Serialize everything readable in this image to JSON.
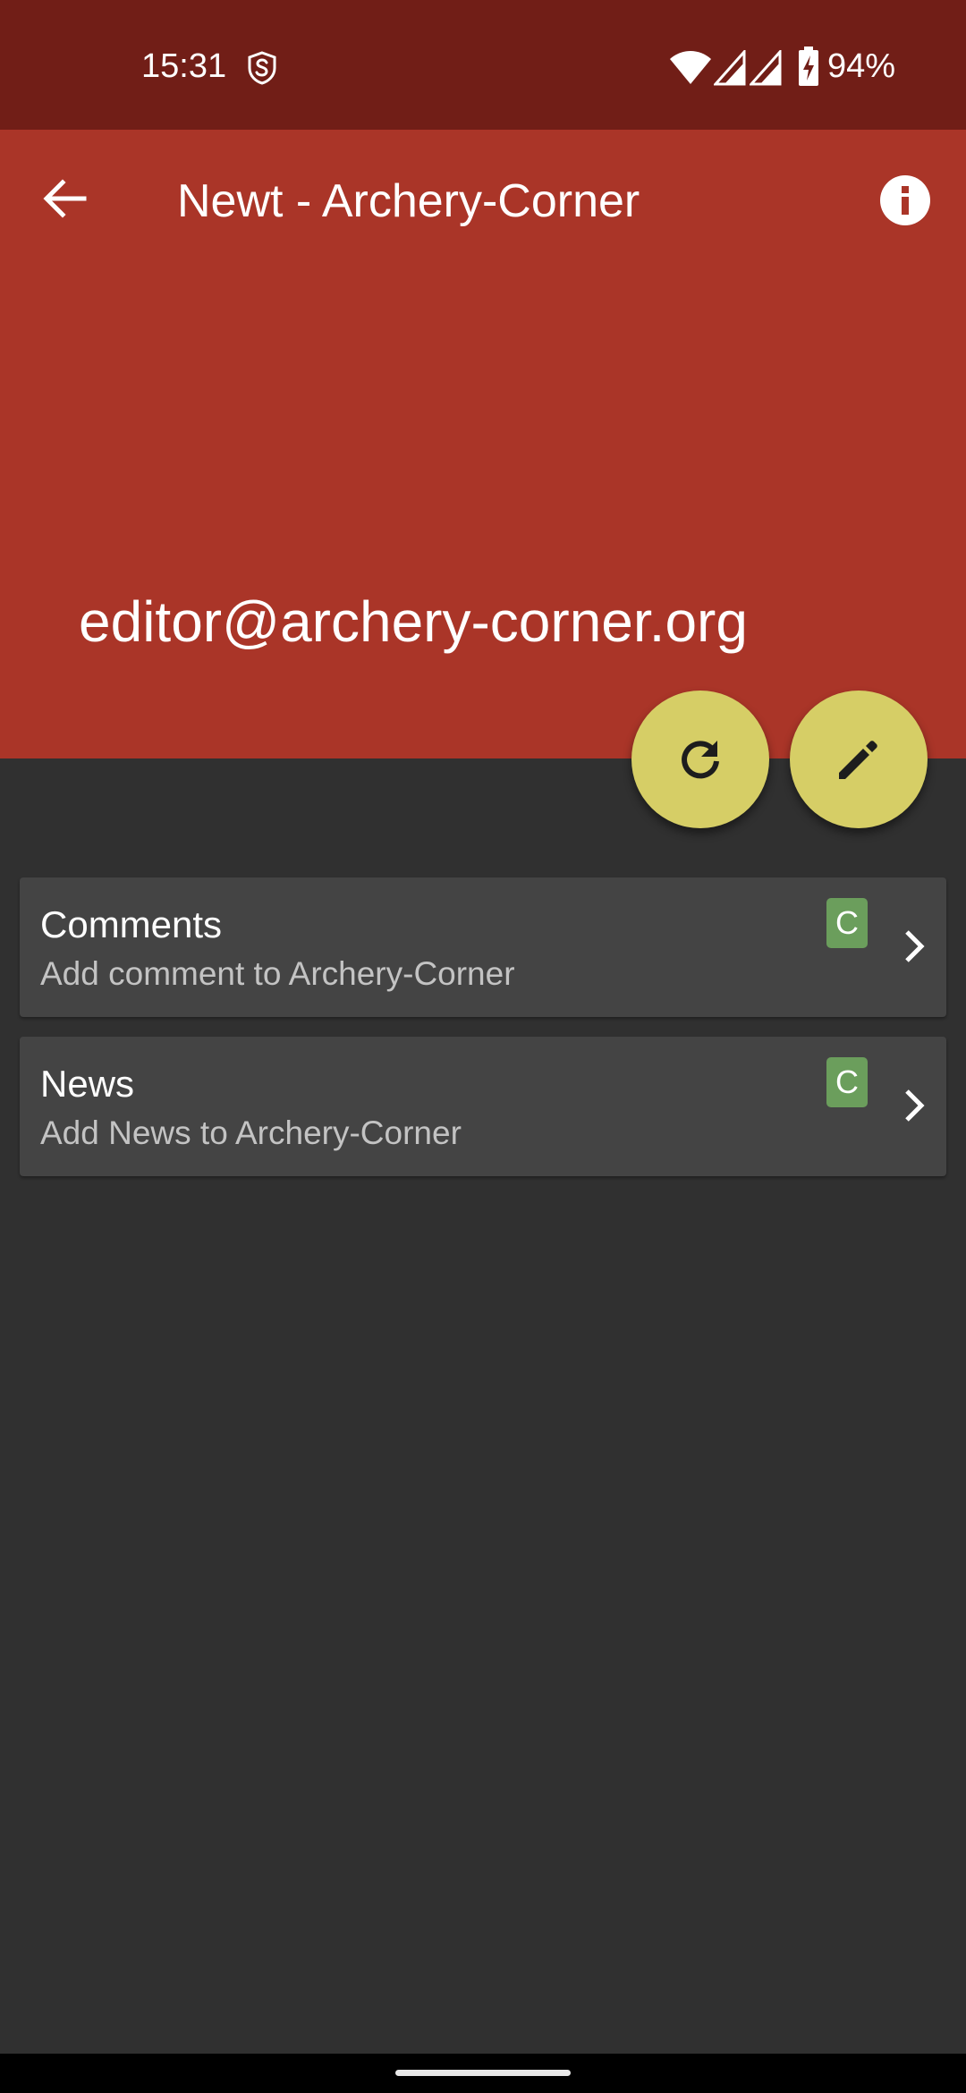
{
  "status_bar": {
    "time": "15:31",
    "notification_icon": "shield-s-icon",
    "wifi_icon": "wifi-icon",
    "signal_icons": [
      "signal-icon",
      "signal-icon"
    ],
    "battery_icon": "battery-charging-icon",
    "battery_percent": "94%"
  },
  "app_bar": {
    "back_icon": "arrow-left-icon",
    "title": "Newt - Archery-Corner",
    "info_icon": "info-icon",
    "email": "editor@archery-corner.org",
    "color": "#aa3528"
  },
  "fabs": [
    {
      "name": "refresh",
      "icon": "refresh-icon"
    },
    {
      "name": "edit",
      "icon": "pencil-icon"
    }
  ],
  "lists": [
    {
      "title": "Comments",
      "subtitle": "Add comment to Archery-Corner",
      "badge": "C"
    },
    {
      "title": "News",
      "subtitle": "Add News to Archery-Corner",
      "badge": "C"
    }
  ],
  "colors": {
    "status_bar": "#711e17",
    "app_bar": "#aa3528",
    "fab": "#d6ce66",
    "background": "#303030",
    "card": "#444444",
    "badge": "#6b9e5c"
  }
}
